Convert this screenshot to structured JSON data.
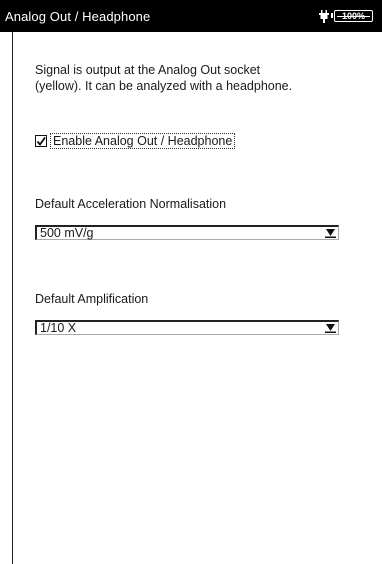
{
  "header": {
    "title": "Analog Out / Headphone",
    "battery_text": "100%",
    "icons": [
      "power-plug-icon",
      "battery-icon"
    ]
  },
  "description": {
    "line1": "Signal is output at the Analog Out socket",
    "line2": "(yellow). It can be analyzed with a headphone."
  },
  "enable_option": {
    "label": "Enable Analog Out / Headphone",
    "checked": true
  },
  "acceleration": {
    "label": "Default Acceleration Normalisation",
    "value": "500 mV/g"
  },
  "amplification": {
    "label": "Default Amplification",
    "value": "1/10 X"
  }
}
